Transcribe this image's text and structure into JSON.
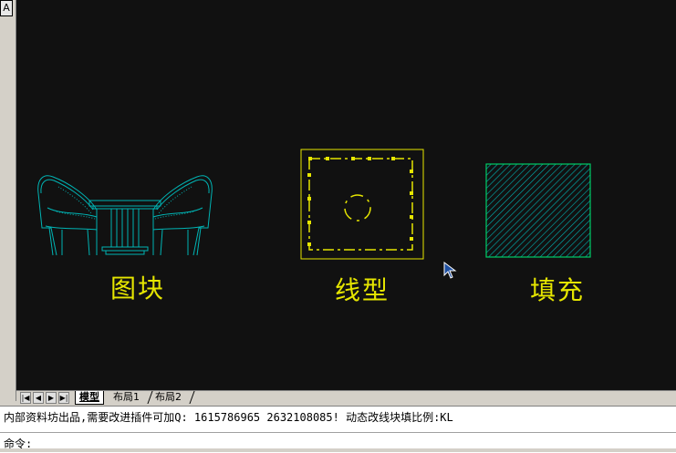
{
  "corner_label": "A",
  "labels": {
    "block": "图块",
    "linetype": "线型",
    "fill": "填充"
  },
  "tabs": [
    {
      "label": "模型",
      "active": true
    },
    {
      "label": "布局1",
      "active": false
    },
    {
      "label": "布局2",
      "active": false
    }
  ],
  "nav_icons": [
    "first-tab-icon",
    "prev-tab-icon",
    "next-tab-icon",
    "last-tab-icon"
  ],
  "command": {
    "history_line": "内部资料坊出品,需要改进插件可加Q: 1615786965 2632108085! 动态改线块填比例:KL",
    "prompt": "命令:"
  },
  "colors": {
    "canvas_bg": "#111111",
    "block_color": "#00b4b4",
    "linetype_color": "#e6e600",
    "fill_color": "#00cc66",
    "label_color": "#e6e600"
  }
}
